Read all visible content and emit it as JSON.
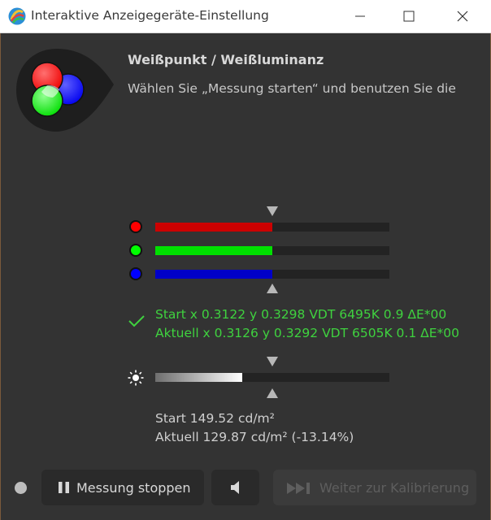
{
  "window": {
    "title": "Interaktive Anzeigegeräte-Einstellung"
  },
  "header": {
    "heading": "Weißpunkt / Weißluminanz",
    "instruction": "Wählen Sie „Messung starten“ und benutzen Sie die"
  },
  "rgb": {
    "channels": [
      {
        "name": "red",
        "color": "#ff0000",
        "bar_color": "#cc0000",
        "level": 0.5
      },
      {
        "name": "green",
        "color": "#00ff00",
        "bar_color": "#00e000",
        "level": 0.5
      },
      {
        "name": "blue",
        "color": "#0000ff",
        "bar_color": "#0000c8",
        "level": 0.5
      }
    ],
    "start_line": "Start x 0.3122 y 0.3298 VDT 6495K 0.9 ΔE*00",
    "current_line": "Aktuell x 0.3126 y 0.3292 VDT 6505K 0.1 ΔE*00",
    "status_color": "#3fd23f"
  },
  "luminance": {
    "level": 0.37,
    "start_line": "Start 149.52 cd/m²",
    "current_line": "Aktuell 129.87 cd/m² (-13.14%)"
  },
  "footer": {
    "stop_label": "Messung stoppen",
    "next_label": "Weiter zur Kalibrierung"
  },
  "icons": {
    "app": "app-logo-icon",
    "minimize": "minimize-icon",
    "maximize": "maximize-icon",
    "close": "close-icon",
    "rgb_logo": "rgb-circles-icon",
    "check": "check-icon",
    "sun": "sun-icon",
    "pause": "pause-icon",
    "speaker": "speaker-icon",
    "skip": "skip-forward-icon"
  }
}
